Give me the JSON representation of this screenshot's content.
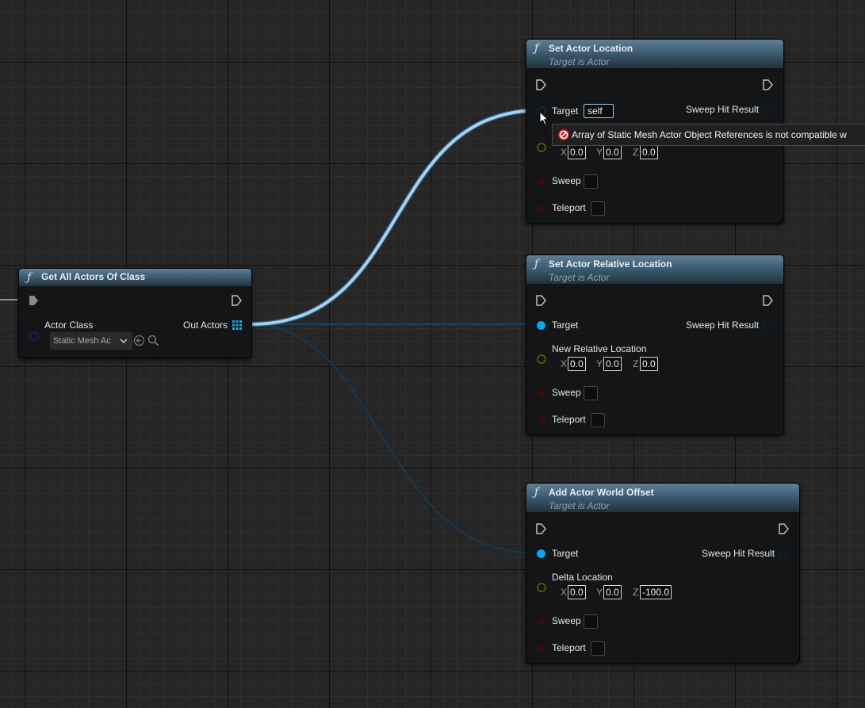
{
  "nodes": {
    "get_all_actors": {
      "title": "Get All Actors Of Class",
      "actor_class_label": "Actor Class",
      "actor_class_value": "Static Mesh Ac",
      "out_actors_label": "Out Actors"
    },
    "set_actor_location": {
      "title": "Set Actor Location",
      "subtitle": "Target is Actor",
      "target_label": "Target",
      "target_value": "self",
      "sweep_hit_label": "Sweep Hit Result",
      "x_label": "X",
      "x_value": "0.0",
      "y_label": "Y",
      "y_value": "0.0",
      "z_label": "Z",
      "z_value": "0.0",
      "sweep_label": "Sweep",
      "teleport_label": "Teleport"
    },
    "set_actor_relative_location": {
      "title": "Set Actor Relative Location",
      "subtitle": "Target is Actor",
      "target_label": "Target",
      "sweep_hit_label": "Sweep Hit Result",
      "location_label": "New Relative Location",
      "x_label": "X",
      "x_value": "0.0",
      "y_label": "Y",
      "y_value": "0.0",
      "z_label": "Z",
      "z_value": "0.0",
      "sweep_label": "Sweep",
      "teleport_label": "Teleport"
    },
    "add_actor_world_offset": {
      "title": "Add Actor World Offset",
      "subtitle": "Target is Actor",
      "target_label": "Target",
      "sweep_hit_label": "Sweep Hit Result",
      "offset_label": "Delta Location",
      "x_label": "X",
      "x_value": "0.0",
      "y_label": "Y",
      "y_value": "0.0",
      "z_label": "Z",
      "z_value": "-100.0",
      "sweep_label": "Sweep",
      "teleport_label": "Teleport"
    }
  },
  "tooltip": {
    "text": "Array of Static Mesh Actor Object References is not compatible w"
  },
  "colors": {
    "grid_bg": "#262626",
    "node_body": "#131516",
    "object_pin": "#0aa4f0",
    "active_wire": "#8cc8f2",
    "dim_wire": "#16405e",
    "error_icon": "#e02020"
  },
  "icons": [
    "function-icon",
    "exec-pin-icon",
    "array-grid-icon",
    "dropdown-chevron-icon",
    "use-selected-icon",
    "browse-search-icon",
    "block-error-icon",
    "mouse-cursor-icon"
  ]
}
